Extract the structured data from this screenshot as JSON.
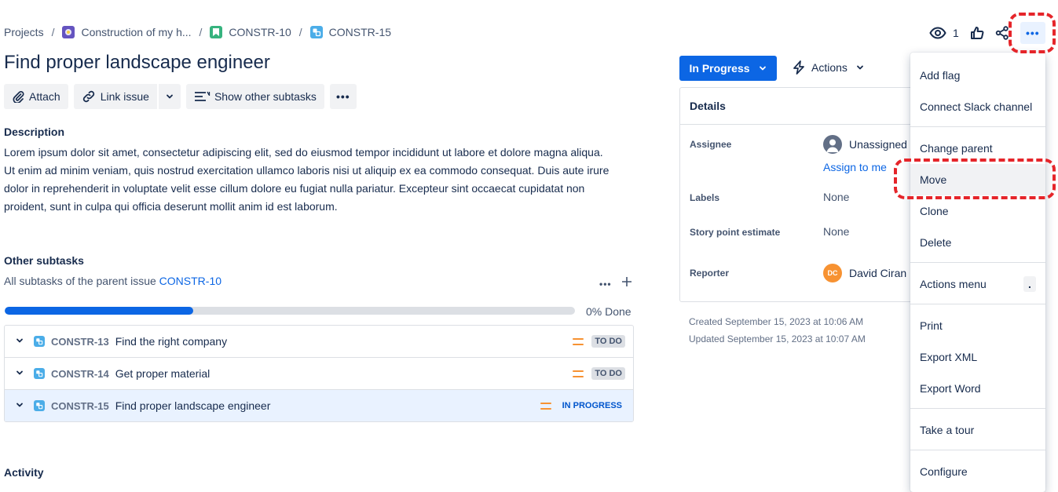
{
  "breadcrumb": {
    "projects": "Projects",
    "project": "Construction of my h...",
    "parent_key": "CONSTR-10",
    "issue_key": "CONSTR-15",
    "separator": "/"
  },
  "header": {
    "watch_count": "1"
  },
  "issue": {
    "title": "Find proper landscape engineer"
  },
  "toolbar": {
    "attach_label": "Attach",
    "link_label": "Link issue",
    "show_subtasks_label": "Show other subtasks"
  },
  "description": {
    "heading": "Description",
    "text": "Lorem ipsum dolor sit amet, consectetur adipiscing elit, sed do eiusmod tempor incididunt ut labore et dolore magna aliqua. Ut enim ad minim veniam, quis nostrud exercitation ullamco laboris nisi ut aliquip ex ea commodo consequat. Duis aute irure dolor in reprehenderit in voluptate velit esse cillum dolore eu fugiat nulla pariatur. Excepteur sint occaecat cupidatat non proident, sunt in culpa qui officia deserunt mollit anim id est laborum."
  },
  "subtasks": {
    "heading": "Other subtasks",
    "caption_prefix": "All subtasks of the parent issue",
    "caption_link": "CONSTR-10",
    "progress_percent": 0.33,
    "progress_label": "0% Done",
    "items": [
      {
        "key": "CONSTR-13",
        "summary": "Find the right company",
        "status": "TO DO"
      },
      {
        "key": "CONSTR-14",
        "summary": "Get proper material",
        "status": "TO DO"
      },
      {
        "key": "CONSTR-15",
        "summary": "Find proper landscape engineer",
        "status": "IN PROGRESS"
      }
    ]
  },
  "activity": {
    "heading": "Activity"
  },
  "status_button": {
    "label": "In Progress"
  },
  "actions_button": {
    "label": "Actions"
  },
  "details": {
    "heading": "Details",
    "assignee_label": "Assignee",
    "assignee_value": "Unassigned",
    "assign_to_me": "Assign to me",
    "labels_label": "Labels",
    "labels_value": "None",
    "story_points_label": "Story point estimate",
    "story_points_value": "None",
    "reporter_label": "Reporter",
    "reporter_initials": "DC",
    "reporter_value": "David Ciran"
  },
  "meta": {
    "created": "Created September 15, 2023 at 10:06 AM",
    "updated": "Updated September 15, 2023 at 10:07 AM"
  },
  "menu": {
    "add_flag": "Add flag",
    "connect_slack": "Connect Slack channel",
    "change_parent": "Change parent",
    "move": "Move",
    "clone": "Clone",
    "delete": "Delete",
    "actions_menu": "Actions menu",
    "actions_menu_shortcut": ".",
    "print": "Print",
    "export_xml": "Export XML",
    "export_word": "Export Word",
    "take_tour": "Take a tour",
    "configure": "Configure"
  },
  "colors": {
    "accent": "#0c66e4",
    "highlight_ring": "#e5252a",
    "priority_medium": "#f79232"
  }
}
